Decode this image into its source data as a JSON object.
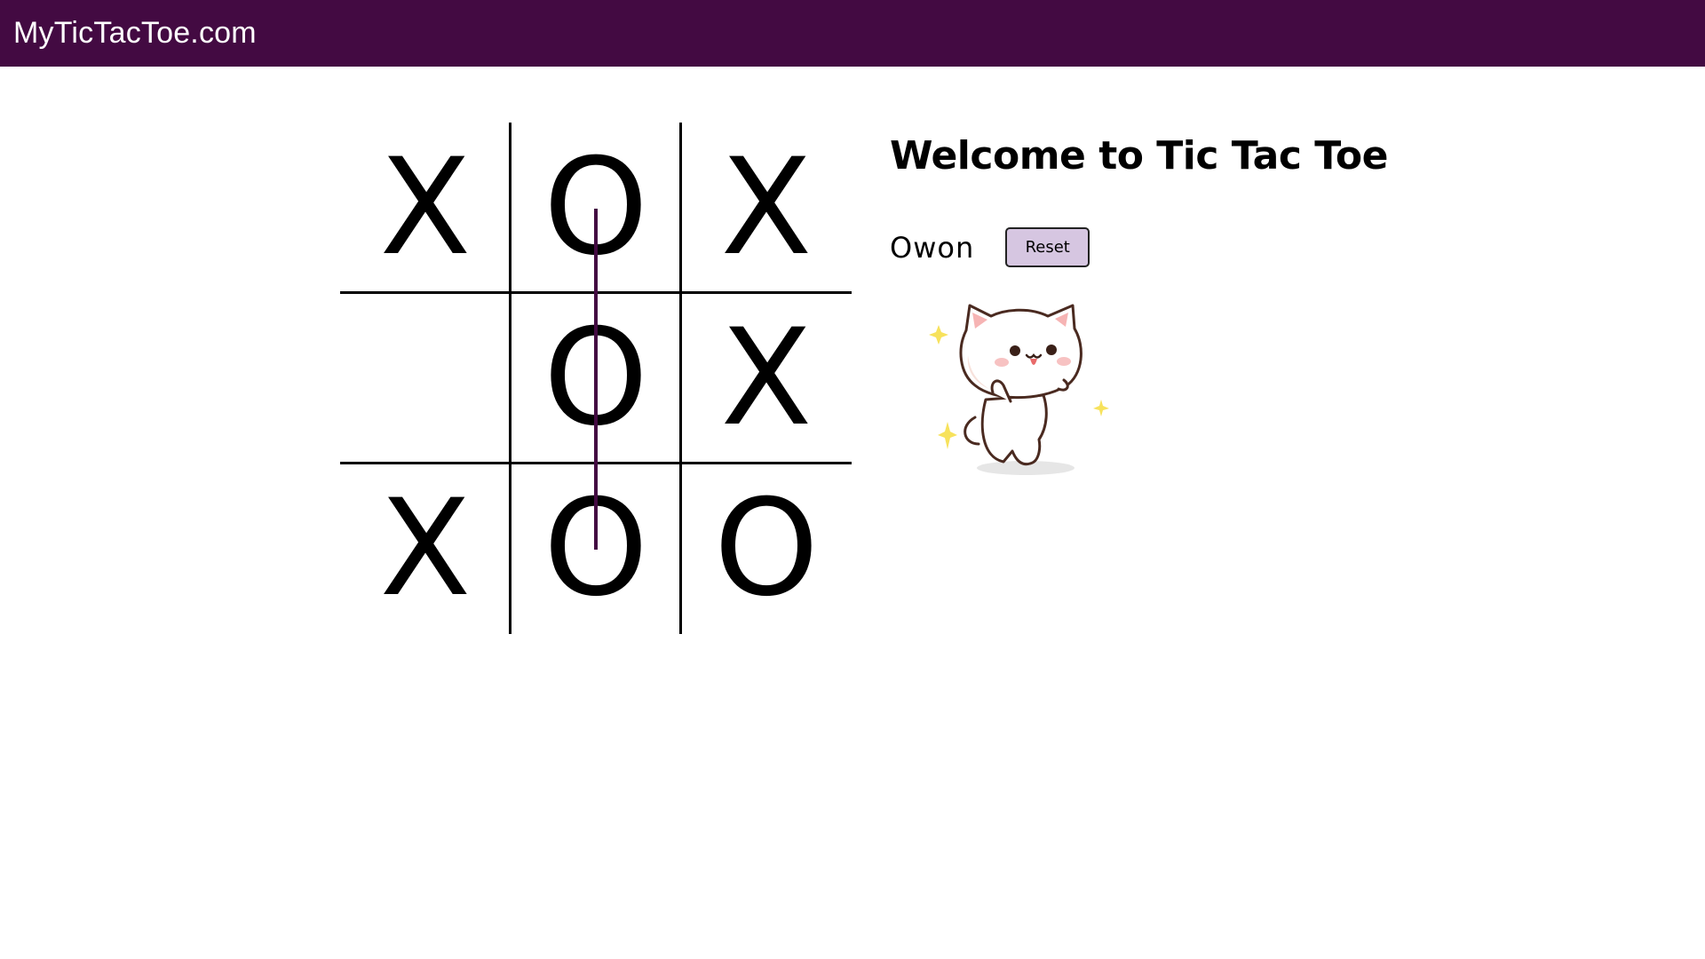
{
  "header": {
    "brand": "MyTicTacToe.com"
  },
  "board": {
    "cells": [
      "X",
      "O",
      "X",
      "",
      "O",
      "X",
      "X",
      "O",
      "O"
    ],
    "winning_line": "middle-column"
  },
  "sidebar": {
    "title": "Welcome to Tic Tac Toe",
    "status": "Owon",
    "reset_label": "Reset"
  },
  "mascot": {
    "icon": "happy-cat-icon"
  },
  "colors": {
    "header_bg": "#430a42",
    "win_line": "#430a42",
    "reset_bg": "#d6c6e1"
  }
}
